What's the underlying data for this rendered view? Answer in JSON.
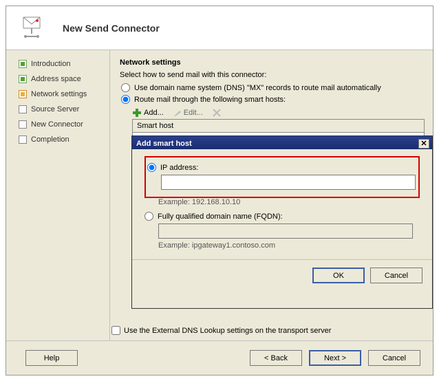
{
  "header": {
    "title": "New Send Connector"
  },
  "sidebar": {
    "steps": [
      {
        "label": "Introduction",
        "state": "done"
      },
      {
        "label": "Address space",
        "state": "done"
      },
      {
        "label": "Network settings",
        "state": "active"
      },
      {
        "label": "Source Server",
        "state": "pending"
      },
      {
        "label": "New Connector",
        "state": "pending"
      },
      {
        "label": "Completion",
        "state": "pending"
      }
    ]
  },
  "content": {
    "section_title": "Network settings",
    "subtitle": "Select how to send mail with this connector:",
    "option_dns": "Use domain name system (DNS) \"MX\" records to route mail automatically",
    "option_smart": "Route mail through the following smart hosts:",
    "toolbar": {
      "add": "Add...",
      "edit": "Edit...",
      "delete": ""
    },
    "table": {
      "header": "Smart host"
    },
    "external_dns": "Use the External DNS Lookup settings on the transport server"
  },
  "dialog": {
    "title": "Add smart host",
    "ip_label": "IP address:",
    "ip_value": "",
    "ip_hint": "Example: 192.168.10.10",
    "fqdn_label": "Fully qualified domain name (FQDN):",
    "fqdn_value": "",
    "fqdn_hint": "Example: ipgateway1.contoso.com",
    "ok": "OK",
    "cancel": "Cancel"
  },
  "footer": {
    "help": "Help",
    "back": "< Back",
    "next": "Next >",
    "cancel": "Cancel"
  }
}
